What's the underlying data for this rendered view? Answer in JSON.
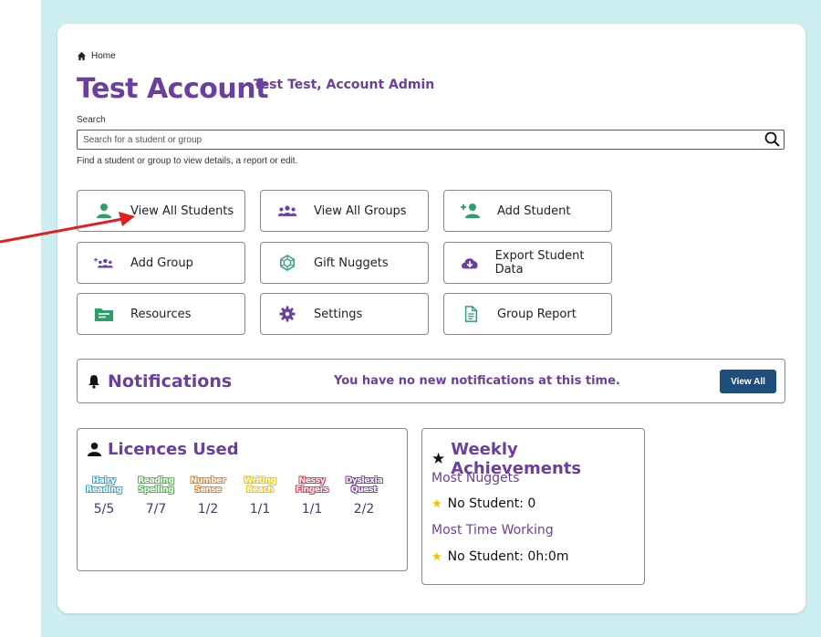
{
  "breadcrumb": {
    "home_label": "Home"
  },
  "header": {
    "title": "Test Account",
    "subtitle": "Test Test, Account Admin"
  },
  "search": {
    "label": "Search",
    "placeholder": "Search for a student or group",
    "value": "",
    "hint": "Find a student or group to view details, a report or edit."
  },
  "tiles": [
    {
      "label": "View All Students",
      "icon": "person-icon"
    },
    {
      "label": "View All Groups",
      "icon": "people-group-icon"
    },
    {
      "label": "Add Student",
      "icon": "add-person-icon"
    },
    {
      "label": "Add Group",
      "icon": "add-group-icon"
    },
    {
      "label": "Gift Nuggets",
      "icon": "gem-icon"
    },
    {
      "label": "Export Student Data",
      "icon": "cloud-download-icon"
    },
    {
      "label": "Resources",
      "icon": "folder-icon"
    },
    {
      "label": "Settings",
      "icon": "gear-icon"
    },
    {
      "label": "Group Report",
      "icon": "document-icon"
    }
  ],
  "notifications": {
    "heading": "Notifications",
    "message": "You have no new notifications at this time.",
    "button_label": "View All"
  },
  "licences": {
    "heading": "Licences Used",
    "products": [
      {
        "name": [
          "Hairy",
          "Reading"
        ],
        "count": "5/5",
        "color": "#2ea6e6"
      },
      {
        "name": [
          "Reading",
          "Spelling"
        ],
        "count": "7/7",
        "color": "#4cb84a"
      },
      {
        "name": [
          "Number",
          "Sense"
        ],
        "count": "1/2",
        "color": "#f07a1e"
      },
      {
        "name": [
          "Writing",
          "Beach"
        ],
        "count": "1/1",
        "color": "#f2c200"
      },
      {
        "name": [
          "Nessy",
          "Fingers"
        ],
        "count": "1/1",
        "color": "#e8324a"
      },
      {
        "name": [
          "Dyslexia",
          "Quest"
        ],
        "count": "2/2",
        "color": "#7a3fb0"
      }
    ]
  },
  "achievements": {
    "heading": "Weekly Achievements",
    "nuggets_label": "Most Nuggets",
    "nuggets_value": "No Student: 0",
    "time_label": "Most Time Working",
    "time_value": "No Student: 0h:0m"
  },
  "colors": {
    "brand_purple": "#6b3fa0",
    "teal_icon": "#2e9e6b",
    "button_blue": "#1e4e7d",
    "arrow_red": "#e02020"
  }
}
